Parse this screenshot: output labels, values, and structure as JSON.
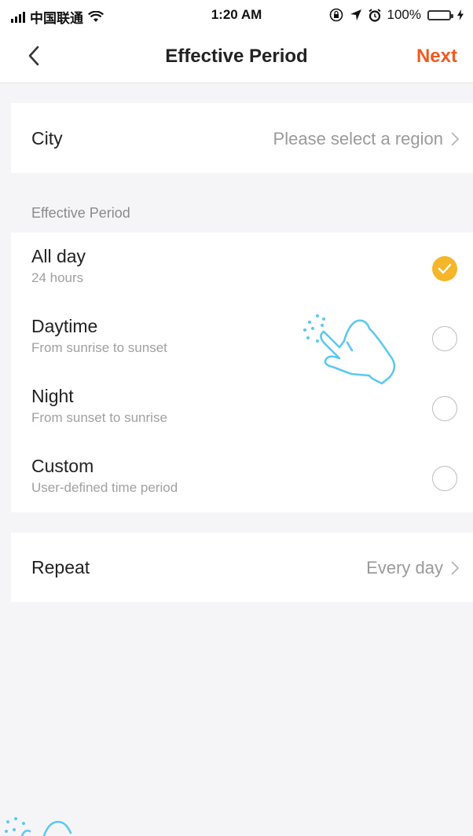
{
  "status_bar": {
    "carrier": "中国联通",
    "time": "1:20 AM",
    "battery": "100%",
    "icons": [
      "signal-icon",
      "wifi-icon",
      "orientation-lock-icon",
      "location-icon",
      "alarm-icon",
      "battery-icon",
      "charging-icon"
    ]
  },
  "nav": {
    "title": "Effective Period",
    "next_label": "Next",
    "back_icon": "chevron-left-icon"
  },
  "city": {
    "label": "City",
    "value": "Please select a region"
  },
  "period_section": {
    "header": "Effective Period",
    "options": [
      {
        "title": "All day",
        "subtitle": "24 hours",
        "selected": true
      },
      {
        "title": "Daytime",
        "subtitle": "From sunrise to sunset",
        "selected": false
      },
      {
        "title": "Night",
        "subtitle": "From sunset to sunrise",
        "selected": false
      },
      {
        "title": "Custom",
        "subtitle": "User-defined time period",
        "selected": false
      }
    ]
  },
  "repeat": {
    "label": "Repeat",
    "value": "Every day"
  },
  "colors": {
    "accent": "#f05a22",
    "selected": "#f5b62a",
    "hand_overlay": "#5cc8f0",
    "background": "#f5f5f7"
  }
}
